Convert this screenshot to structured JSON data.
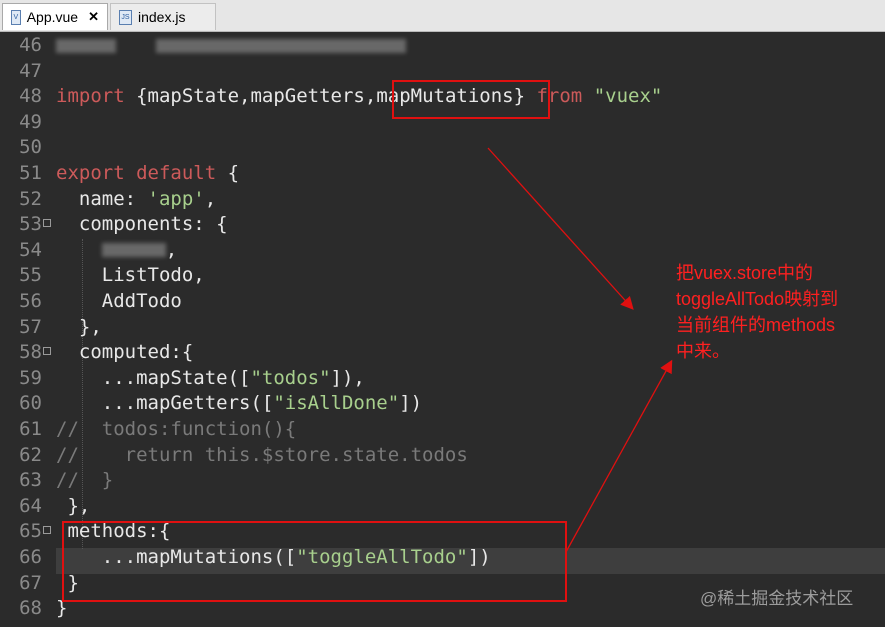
{
  "tabs": [
    {
      "label": "App.vue",
      "close": "✕",
      "icon": "vue-file-icon",
      "active": true
    },
    {
      "label": "index.js",
      "icon": "js-file-icon",
      "badge": "JS",
      "active": false
    }
  ],
  "lines": [
    {
      "num": "46"
    },
    {
      "num": "47"
    },
    {
      "num": "48",
      "t": [
        {
          "k": "kw",
          "v": "import"
        },
        {
          "v": " {mapState,mapGetters,"
        },
        {
          "v": "mapMutations"
        },
        {
          "v": "} "
        },
        {
          "k": "kw",
          "v": "from"
        },
        {
          "v": " "
        },
        {
          "k": "str",
          "v": "\"vuex\""
        }
      ]
    },
    {
      "num": "49"
    },
    {
      "num": "50"
    },
    {
      "num": "51",
      "t": [
        {
          "k": "kw",
          "v": "export"
        },
        {
          "v": " "
        },
        {
          "k": "kw",
          "v": "default"
        },
        {
          "v": " {"
        }
      ]
    },
    {
      "num": "52",
      "t": [
        {
          "v": "  name: "
        },
        {
          "k": "str",
          "v": "'app'"
        },
        {
          "v": ","
        }
      ]
    },
    {
      "num": "53",
      "t": [
        {
          "v": "  components: {"
        }
      ]
    },
    {
      "num": "54",
      "t": [
        {
          "v": "    "
        },
        {
          "v": ","
        }
      ]
    },
    {
      "num": "55",
      "t": [
        {
          "v": "    ListTodo,"
        }
      ]
    },
    {
      "num": "56",
      "t": [
        {
          "v": "    AddTodo"
        }
      ]
    },
    {
      "num": "57",
      "t": [
        {
          "v": "  },"
        }
      ]
    },
    {
      "num": "58",
      "t": [
        {
          "v": "  computed:{"
        }
      ]
    },
    {
      "num": "59",
      "t": [
        {
          "v": "    ...mapState(["
        },
        {
          "k": "str",
          "v": "\"todos\""
        },
        {
          "v": "]),"
        }
      ]
    },
    {
      "num": "60",
      "t": [
        {
          "v": "    ...mapGetters(["
        },
        {
          "k": "str",
          "v": "\"isAllDone\""
        },
        {
          "v": "])"
        }
      ]
    },
    {
      "num": "61",
      "t": [
        {
          "k": "cmt",
          "v": "//  todos:function(){"
        }
      ]
    },
    {
      "num": "62",
      "t": [
        {
          "k": "cmt",
          "v": "//    return this.$store.state.todos"
        }
      ]
    },
    {
      "num": "63",
      "t": [
        {
          "k": "cmt",
          "v": "//  }"
        }
      ]
    },
    {
      "num": "64",
      "t": [
        {
          "v": " },"
        }
      ]
    },
    {
      "num": "65",
      "t": [
        {
          "v": " methods:{"
        }
      ]
    },
    {
      "num": "66",
      "t": [
        {
          "v": "    ...mapMutations(["
        },
        {
          "k": "str",
          "v": "\"toggleAllTodo\""
        },
        {
          "v": "])"
        }
      ]
    },
    {
      "num": "67",
      "t": [
        {
          "v": " }"
        }
      ]
    },
    {
      "num": "68",
      "t": [
        {
          "v": "}"
        }
      ]
    }
  ],
  "annotation": {
    "lines": [
      "把vuex.store中的",
      "toggleAllTodo映射到",
      "当前组件的methods",
      "中来。"
    ]
  },
  "watermark": "@稀土掘金技术社区",
  "colors": {
    "annotation": "#ff2020",
    "keyword": "#cc5a5a",
    "string": "#a8d08d",
    "comment": "#7a7a7a",
    "background": "#2b2b2b"
  }
}
